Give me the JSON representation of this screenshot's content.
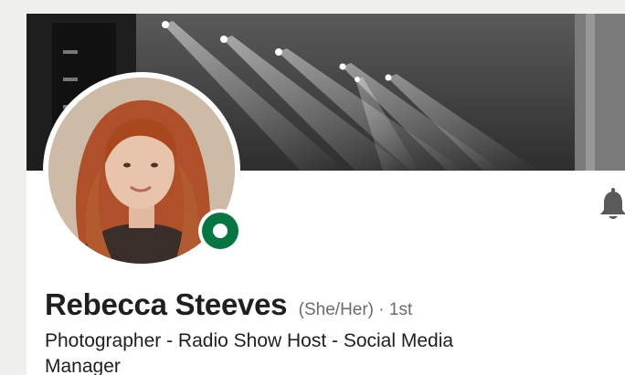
{
  "profile": {
    "name": "Rebecca Steeves",
    "pronouns": "(She/Her)",
    "separator": " · ",
    "connection_degree": "1st",
    "headline": "Photographer - Radio Show Host - Social Media Manager",
    "online_status": "online",
    "status_color": "#057642"
  },
  "banner": {
    "description_icon": "stage-lights-photo"
  },
  "actions": {
    "notify_icon": "bell-icon"
  }
}
